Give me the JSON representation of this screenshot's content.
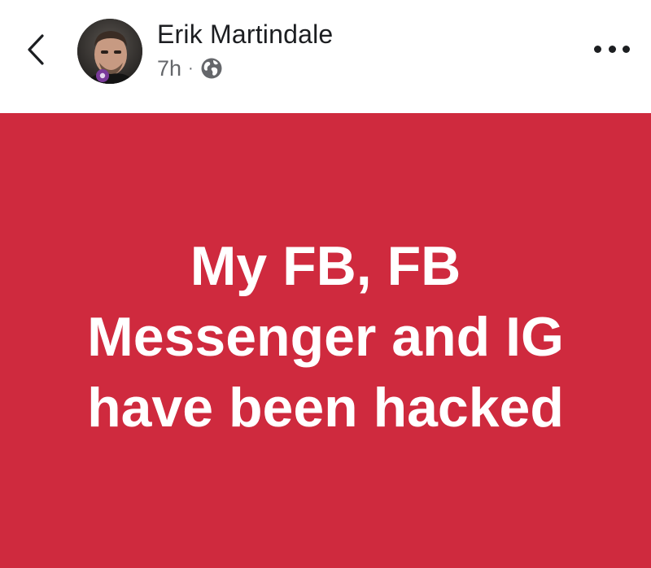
{
  "header": {
    "author_name": "Erik Martindale",
    "timestamp": "7h",
    "separator": "·",
    "privacy_icon": "globe-icon",
    "back_icon": "chevron-left-icon",
    "more_icon": "more-horizontal-icon"
  },
  "post": {
    "lines": [
      "My FB, FB",
      "Messenger and IG",
      "have been hacked"
    ],
    "background_color": "#cf2a3e",
    "text_color": "#ffffff"
  }
}
